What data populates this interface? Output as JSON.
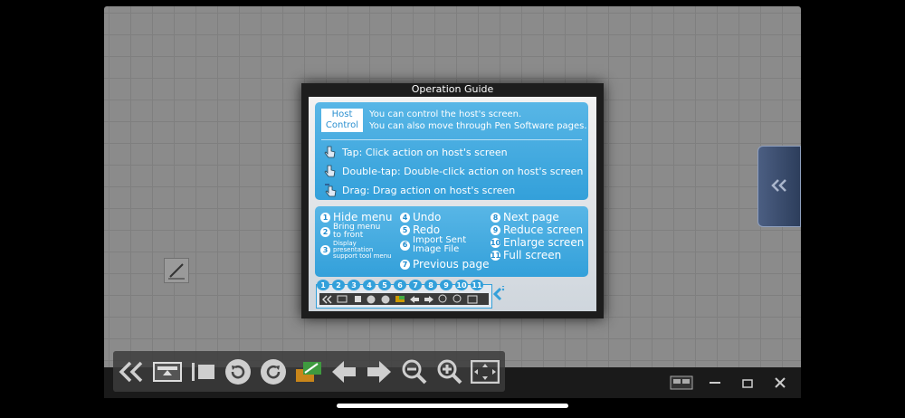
{
  "guide": {
    "title": "Operation Guide",
    "host_badge": "Host\nControl",
    "host_line1": "You can control the host's screen.",
    "host_line2": "You can also move through Pen Software pages.",
    "actions": [
      {
        "label": "Tap: Click action on host's screen"
      },
      {
        "label": "Double-tap: Double-click action on host's screen"
      },
      {
        "label": "Drag: Drag action on host's screen"
      }
    ],
    "items": [
      {
        "n": "1",
        "label": "Hide menu"
      },
      {
        "n": "2",
        "label": "Bring menu\nto front"
      },
      {
        "n": "3",
        "label": "Display\npresentation\nsupport tool menu"
      },
      {
        "n": "4",
        "label": "Undo"
      },
      {
        "n": "5",
        "label": "Redo"
      },
      {
        "n": "6",
        "label": "Import Sent\nImage File"
      },
      {
        "n": "7",
        "label": "Previous page"
      },
      {
        "n": "8",
        "label": "Next page"
      },
      {
        "n": "9",
        "label": "Reduce screen"
      },
      {
        "n": "10",
        "label": "Enlarge screen"
      },
      {
        "n": "11",
        "label": "Full screen"
      }
    ],
    "toolbar_numbers": [
      "1",
      "2",
      "3",
      "4",
      "5",
      "6",
      "7",
      "8",
      "9",
      "10",
      "11"
    ]
  },
  "colors": {
    "accent": "#33a0da",
    "screen_bg": "#8b8b8b"
  },
  "icons": [
    "double-chevron-left-icon",
    "bring-front-icon",
    "presentation-tool-icon",
    "undo-icon",
    "redo-icon",
    "import-image-icon",
    "arrow-left-icon",
    "arrow-right-icon",
    "zoom-out-icon",
    "zoom-in-icon",
    "full-screen-icon"
  ]
}
